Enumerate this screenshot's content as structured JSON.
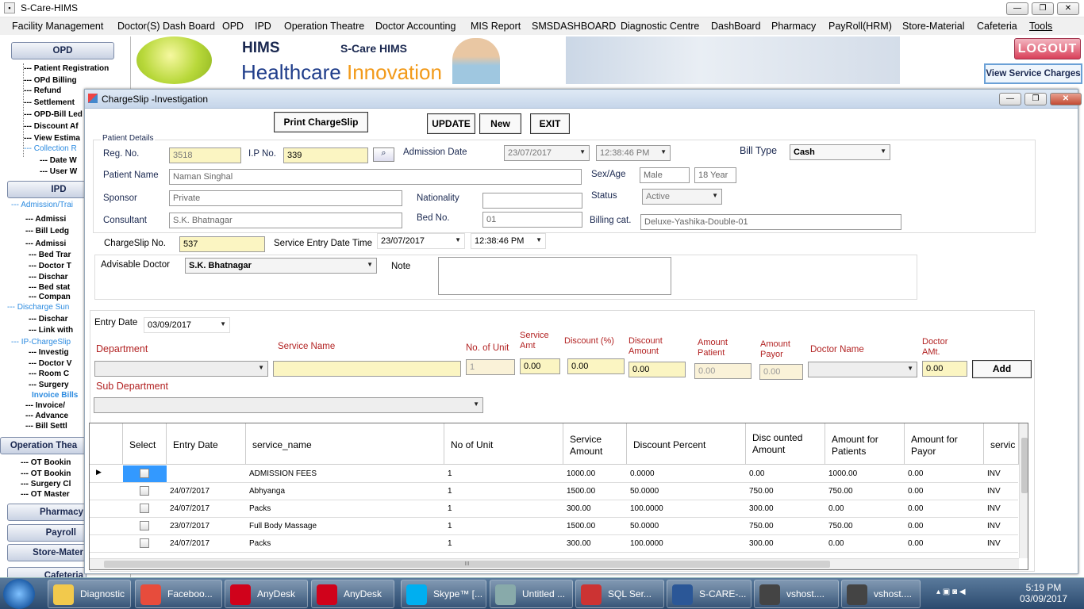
{
  "app": {
    "title": "S-Care-HIMS"
  },
  "menu": [
    "Facility Management",
    "Doctor(S) Dash Board",
    "OPD",
    "IPD",
    "Operation Theatre",
    "Doctor Accounting",
    "MIS Report",
    "SMSDASHBOARD",
    "Diagnostic Centre",
    "DashBoard",
    "Pharmacy",
    "PayRoll(HRM)",
    "Store-Material",
    "Cafeteria",
    "Tools"
  ],
  "sidebar": {
    "opd": "OPD",
    "opd_items": [
      "Patient Registration",
      "OPd Billing",
      "Refund",
      "Settlement",
      "OPD-Bill Led",
      "Discount Af",
      "View Estima",
      "Collection R",
      "Date W",
      "User W"
    ],
    "ipd": "IPD",
    "ipd_admission": "Admission/Trai",
    "ipd_items": [
      "Admissi",
      "Bill Ledg",
      "Admissi",
      "Bed Trar",
      "Doctor T",
      "Dischar",
      "Bed stat",
      "Compan"
    ],
    "discharge_sum": "Discharge Sun",
    "discharge_items": [
      "Dischar",
      "Link with"
    ],
    "ip_chargeslip": "IP-ChargeSlip",
    "chargeslip_items": [
      "Investig",
      "Doctor V",
      "Room C",
      "Surgery"
    ],
    "invoice_bills": "Invoice Bills",
    "invoice_items": [
      "Invoice/",
      "Advance",
      "Bill Settl"
    ],
    "operation": "Operation Thea",
    "ot_items": [
      "OT Bookin",
      "OT Bookin",
      "Surgery Cl",
      "OT Master"
    ],
    "pharmacy": "Pharmacy",
    "payroll": "Payroll",
    "store": "Store-Mater",
    "cafeteria": "Cafeteria"
  },
  "banner": {
    "hims": "HIMS",
    "scare": "S-Care HIMS",
    "healthcare": "Healthcare",
    "innovation": "Innovation"
  },
  "logout": "LOGOUT",
  "view_service_charges": "View Service Charges",
  "window": {
    "title": "ChargeSlip -Investigation",
    "print": "Print ChargeSlip",
    "update": "UPDATE",
    "new": "New",
    "exit": "EXIT",
    "patient_details": "Patient Details",
    "reg_no_label": "Reg. No.",
    "reg_no": "3518",
    "ip_no_label": "I.P No.",
    "ip_no": "339",
    "admission_date_label": "Admission Date",
    "admission_date": "23/07/2017",
    "admission_time": "12:38:46 PM",
    "bill_type_label": "Bill Type",
    "bill_type": "Cash",
    "patient_name_label": "Patient Name",
    "patient_name": "Naman Singhal",
    "sex_age_label": "Sex/Age",
    "sex": "Male",
    "age": "18 Year",
    "sponsor_label": "Sponsor",
    "sponsor": "Private",
    "nationality_label": "Nationality",
    "nationality": "",
    "status_label": "Status",
    "status": "Active",
    "consultant_label": "Consultant",
    "consultant": "S.K. Bhatnagar",
    "bed_no_label": "Bed No.",
    "bed_no": "01",
    "billing_cat_label": "Billing cat.",
    "billing_cat": "Deluxe-Yashika-Double-01",
    "chargeslip_no_label": "ChargeSlip No.",
    "chargeslip_no": "537",
    "service_entry_label": "Service Entry Date Time",
    "service_entry_date": "23/07/2017",
    "service_entry_time": "12:38:46 PM",
    "advisable_doctor_label": "Advisable Doctor",
    "advisable_doctor": "S.K. Bhatnagar",
    "note_label": "Note",
    "note": "",
    "entry_date_label": "Entry Date",
    "entry_date": "03/09/2017",
    "department_label": "Department",
    "service_name_label": "Service Name",
    "no_of_unit_label": "No. of Unit",
    "no_of_unit": "1",
    "service_amt_label": "Service Amt",
    "service_amt": "0.00",
    "discount_pct_label": "Discount (%)",
    "discount_pct": "0.00",
    "discount_amount_label": "Discount Amount",
    "discount_amount": "0.00",
    "amount_patient_label": "Amount Patient",
    "amount_patient": "0.00",
    "amount_payor_label": "Amount Payor",
    "amount_payor": "0.00",
    "doctor_name_label": "Doctor Name",
    "doctor_amt_label": "Doctor AMt.",
    "doctor_amt": "0.00",
    "add": "Add",
    "sub_department_label": "Sub Department"
  },
  "grid": {
    "headers": [
      "Select",
      "Entry Date",
      "service_name",
      "No of Unit",
      "Service Amount",
      "Discount Percent",
      "Disc ounted Amount",
      "Amount for Patients",
      "Amount for Payor",
      "servic"
    ],
    "rows": [
      {
        "date": "",
        "name": "ADMISSION FEES",
        "unit": "1",
        "amt": "1000.00",
        "disc_pct": "0.0000",
        "disc_amt": "0.00",
        "pat": "1000.00",
        "payor": "0.00",
        "svc": "INV"
      },
      {
        "date": "24/07/2017",
        "name": "Abhyanga",
        "unit": "1",
        "amt": "1500.00",
        "disc_pct": "50.0000",
        "disc_amt": "750.00",
        "pat": "750.00",
        "payor": "0.00",
        "svc": "INV"
      },
      {
        "date": "24/07/2017",
        "name": "Packs",
        "unit": "1",
        "amt": "300.00",
        "disc_pct": "100.0000",
        "disc_amt": "300.00",
        "pat": "0.00",
        "payor": "0.00",
        "svc": "INV"
      },
      {
        "date": "23/07/2017",
        "name": "Full Body Massage",
        "unit": "1",
        "amt": "1500.00",
        "disc_pct": "50.0000",
        "disc_amt": "750.00",
        "pat": "750.00",
        "payor": "0.00",
        "svc": "INV"
      },
      {
        "date": "24/07/2017",
        "name": "Packs",
        "unit": "1",
        "amt": "300.00",
        "disc_pct": "100.0000",
        "disc_amt": "300.00",
        "pat": "0.00",
        "payor": "0.00",
        "svc": "INV"
      }
    ],
    "scroll_mark": "III"
  },
  "taskbar": {
    "items": [
      "Diagnostic",
      "Faceboo...",
      "AnyDesk",
      "AnyDesk",
      "Skype™ [...",
      "Untitled ...",
      "SQL Ser...",
      "S-CARE-...",
      "vshost....",
      "vshost...."
    ],
    "time": "5:19 PM",
    "date": "03/09/2017"
  }
}
